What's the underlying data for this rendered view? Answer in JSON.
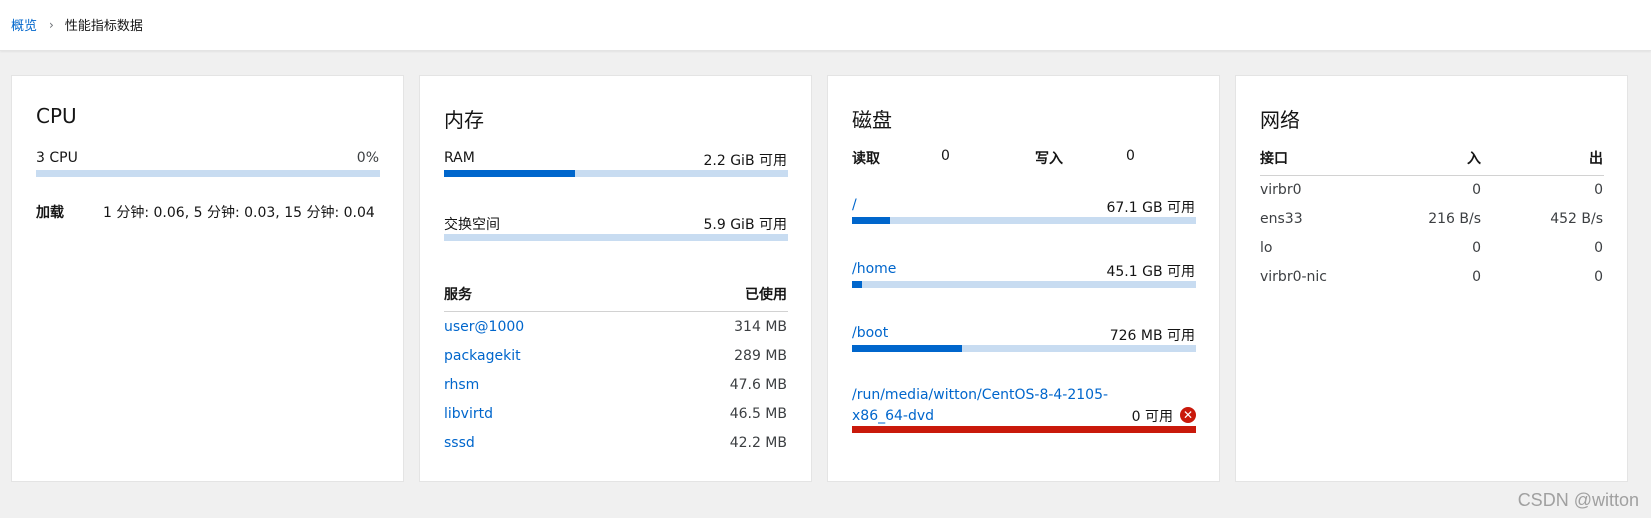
{
  "breadcrumb": {
    "root": "概览",
    "separator": "›",
    "current": "性能指标数据"
  },
  "cpu": {
    "title": "CPU",
    "label": "3 CPU",
    "value": "0%",
    "usage_fraction": 0.0,
    "load_label": "加载",
    "load_value": "1 分钟: 0.06, 5 分钟: 0.03, 15 分钟: 0.04"
  },
  "memory": {
    "title": "内存",
    "ram_label": "RAM",
    "ram_value": "2.2 GiB 可用",
    "ram_used_fraction": 0.38,
    "swap_label": "交换空间",
    "swap_value": "5.9 GiB 可用",
    "swap_used_fraction": 0.0,
    "services_header": "服务",
    "used_header": "已使用",
    "services": [
      {
        "name": "user@1000",
        "used": "314 MB"
      },
      {
        "name": "packagekit",
        "used": "289 MB"
      },
      {
        "name": "rhsm",
        "used": "47.6 MB"
      },
      {
        "name": "libvirtd",
        "used": "46.5 MB"
      },
      {
        "name": "sssd",
        "used": "42.2 MB"
      }
    ]
  },
  "disk": {
    "title": "磁盘",
    "read_label": "读取",
    "read_value": "0",
    "write_label": "写入",
    "write_value": "0",
    "mounts": [
      {
        "path": "/",
        "avail": "67.1 GB 可用",
        "used_fraction": 0.11
      },
      {
        "path": "/home",
        "avail": "45.1 GB 可用",
        "used_fraction": 0.03
      },
      {
        "path": "/boot",
        "avail": "726 MB 可用",
        "used_fraction": 0.32
      }
    ],
    "dvd": {
      "path_line1": "/run/media/witton/CentOS-8-4-2105-",
      "path_line2": "x86_64-dvd",
      "avail": "0 可用",
      "used_fraction": 1.0,
      "icon": "error-circle-icon"
    }
  },
  "network": {
    "title": "网络",
    "headers": {
      "iface": "接口",
      "in": "入",
      "out": "出"
    },
    "rows": [
      {
        "iface": "virbr0",
        "in": "0",
        "out": "0"
      },
      {
        "iface": "ens33",
        "in": "216 B/s",
        "out": "452 B/s"
      },
      {
        "iface": "lo",
        "in": "0",
        "out": "0"
      },
      {
        "iface": "virbr0-nic",
        "in": "0",
        "out": "0"
      }
    ]
  },
  "watermark": "CSDN @witton",
  "colors": {
    "accent": "#0066cc",
    "track": "#c8dcf1",
    "danger": "#c9190b"
  }
}
